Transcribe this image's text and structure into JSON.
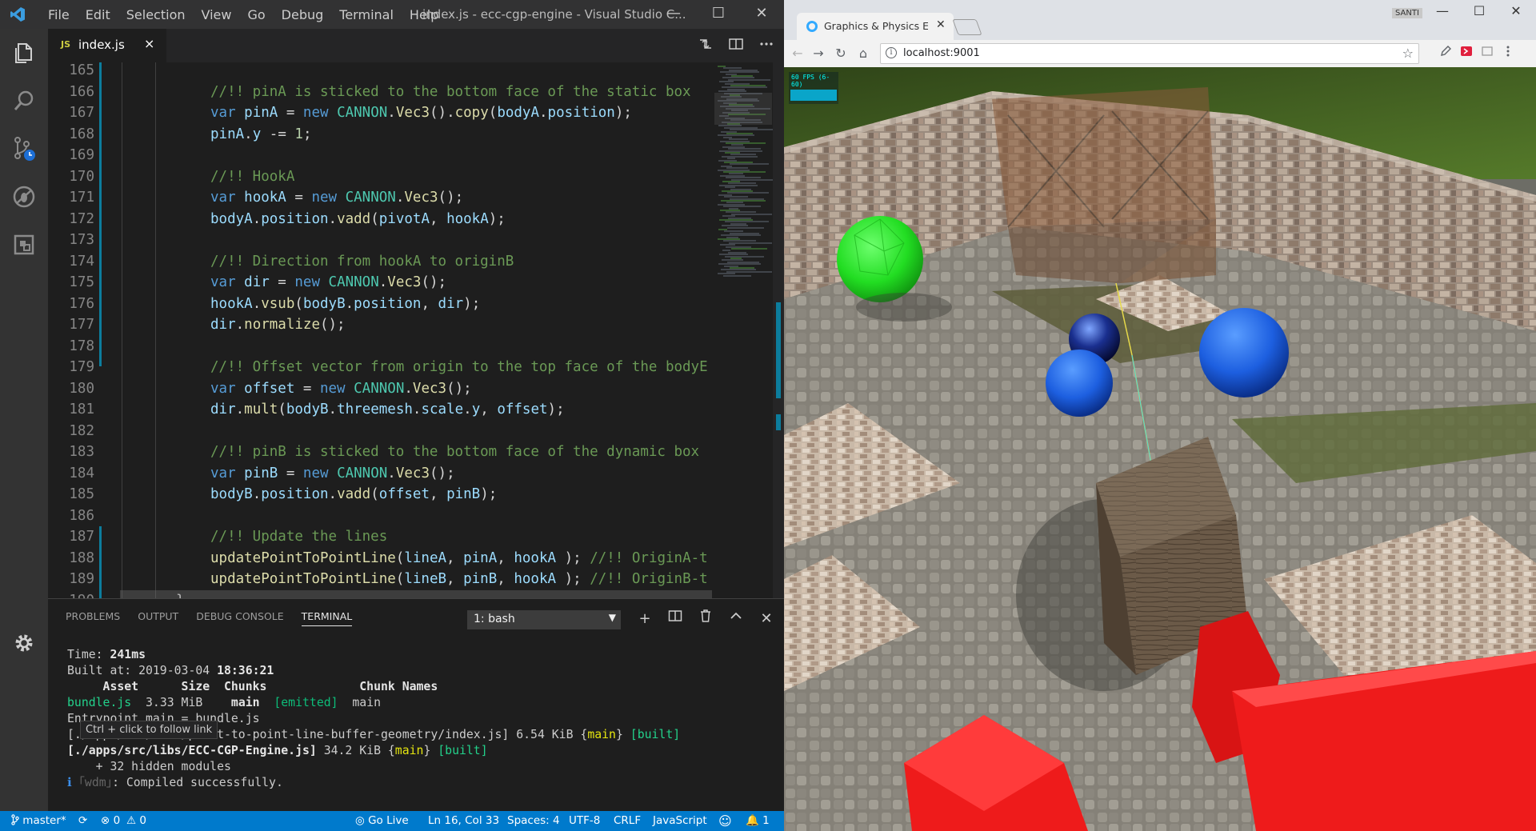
{
  "vscode": {
    "menu": [
      "File",
      "Edit",
      "Selection",
      "View",
      "Go",
      "Debug",
      "Terminal",
      "Help"
    ],
    "window_title": "index.js - ecc-cgp-engine - Visual Studio C...",
    "window_controls": {
      "minimize": "—",
      "maximize": "☐",
      "close": "✕"
    },
    "tab": {
      "icon": "JS",
      "name": "index.js",
      "close": "×"
    },
    "code_lines": [
      {
        "n": "165",
        "t": []
      },
      {
        "n": "166",
        "t": [
          [
            "cm",
            "//!! pinA is sticked to the bottom face of the static box"
          ]
        ]
      },
      {
        "n": "167",
        "t": [
          [
            "kw",
            "var "
          ],
          [
            "var",
            "pinA"
          ],
          [
            "pl",
            " = "
          ],
          [
            "kw",
            "new "
          ],
          [
            "cls",
            "CANNON"
          ],
          [
            "pl",
            "."
          ],
          [
            "fn",
            "Vec3"
          ],
          [
            "pl",
            "()."
          ],
          [
            "fn",
            "copy"
          ],
          [
            "pl",
            "("
          ],
          [
            "var",
            "bodyA"
          ],
          [
            "pl",
            "."
          ],
          [
            "var",
            "position"
          ],
          [
            "pl",
            ");"
          ]
        ]
      },
      {
        "n": "168",
        "t": [
          [
            "var",
            "pinA"
          ],
          [
            "pl",
            "."
          ],
          [
            "var",
            "y"
          ],
          [
            "pl",
            " -= "
          ],
          [
            "num",
            "1"
          ],
          [
            "pl",
            ";"
          ]
        ]
      },
      {
        "n": "169",
        "t": []
      },
      {
        "n": "170",
        "t": [
          [
            "cm",
            "//!! HookA"
          ]
        ]
      },
      {
        "n": "171",
        "t": [
          [
            "kw",
            "var "
          ],
          [
            "var",
            "hookA"
          ],
          [
            "pl",
            " = "
          ],
          [
            "kw",
            "new "
          ],
          [
            "cls",
            "CANNON"
          ],
          [
            "pl",
            "."
          ],
          [
            "fn",
            "Vec3"
          ],
          [
            "pl",
            "();"
          ]
        ]
      },
      {
        "n": "172",
        "t": [
          [
            "var",
            "bodyA"
          ],
          [
            "pl",
            "."
          ],
          [
            "var",
            "position"
          ],
          [
            "pl",
            "."
          ],
          [
            "fn",
            "vadd"
          ],
          [
            "pl",
            "("
          ],
          [
            "var",
            "pivotA"
          ],
          [
            "pl",
            ", "
          ],
          [
            "var",
            "hookA"
          ],
          [
            "pl",
            ");"
          ]
        ]
      },
      {
        "n": "173",
        "t": []
      },
      {
        "n": "174",
        "t": [
          [
            "cm",
            "//!! Direction from hookA to originB"
          ]
        ]
      },
      {
        "n": "175",
        "t": [
          [
            "kw",
            "var "
          ],
          [
            "var",
            "dir"
          ],
          [
            "pl",
            " = "
          ],
          [
            "kw",
            "new "
          ],
          [
            "cls",
            "CANNON"
          ],
          [
            "pl",
            "."
          ],
          [
            "fn",
            "Vec3"
          ],
          [
            "pl",
            "();"
          ]
        ]
      },
      {
        "n": "176",
        "t": [
          [
            "var",
            "hookA"
          ],
          [
            "pl",
            "."
          ],
          [
            "fn",
            "vsub"
          ],
          [
            "pl",
            "("
          ],
          [
            "var",
            "bodyB"
          ],
          [
            "pl",
            "."
          ],
          [
            "var",
            "position"
          ],
          [
            "pl",
            ", "
          ],
          [
            "var",
            "dir"
          ],
          [
            "pl",
            ");"
          ]
        ]
      },
      {
        "n": "177",
        "t": [
          [
            "var",
            "dir"
          ],
          [
            "pl",
            "."
          ],
          [
            "fn",
            "normalize"
          ],
          [
            "pl",
            "();"
          ]
        ]
      },
      {
        "n": "178",
        "t": []
      },
      {
        "n": "179",
        "t": [
          [
            "cm",
            "//!! Offset vector from origin to the top face of the bodyE"
          ]
        ]
      },
      {
        "n": "180",
        "t": [
          [
            "kw",
            "var "
          ],
          [
            "var",
            "offset"
          ],
          [
            "pl",
            " = "
          ],
          [
            "kw",
            "new "
          ],
          [
            "cls",
            "CANNON"
          ],
          [
            "pl",
            "."
          ],
          [
            "fn",
            "Vec3"
          ],
          [
            "pl",
            "();"
          ]
        ]
      },
      {
        "n": "181",
        "t": [
          [
            "var",
            "dir"
          ],
          [
            "pl",
            "."
          ],
          [
            "fn",
            "mult"
          ],
          [
            "pl",
            "("
          ],
          [
            "var",
            "bodyB"
          ],
          [
            "pl",
            "."
          ],
          [
            "var",
            "threemesh"
          ],
          [
            "pl",
            "."
          ],
          [
            "var",
            "scale"
          ],
          [
            "pl",
            "."
          ],
          [
            "var",
            "y"
          ],
          [
            "pl",
            ", "
          ],
          [
            "var",
            "offset"
          ],
          [
            "pl",
            ");"
          ]
        ]
      },
      {
        "n": "182",
        "t": []
      },
      {
        "n": "183",
        "t": [
          [
            "cm",
            "//!! pinB is sticked to the bottom face of the dynamic box"
          ]
        ]
      },
      {
        "n": "184",
        "t": [
          [
            "kw",
            "var "
          ],
          [
            "var",
            "pinB"
          ],
          [
            "pl",
            " = "
          ],
          [
            "kw",
            "new "
          ],
          [
            "cls",
            "CANNON"
          ],
          [
            "pl",
            "."
          ],
          [
            "fn",
            "Vec3"
          ],
          [
            "pl",
            "();"
          ]
        ]
      },
      {
        "n": "185",
        "t": [
          [
            "var",
            "bodyB"
          ],
          [
            "pl",
            "."
          ],
          [
            "var",
            "position"
          ],
          [
            "pl",
            "."
          ],
          [
            "fn",
            "vadd"
          ],
          [
            "pl",
            "("
          ],
          [
            "var",
            "offset"
          ],
          [
            "pl",
            ", "
          ],
          [
            "var",
            "pinB"
          ],
          [
            "pl",
            ");"
          ]
        ]
      },
      {
        "n": "186",
        "t": []
      },
      {
        "n": "187",
        "t": [
          [
            "cm",
            "//!! Update the lines"
          ]
        ]
      },
      {
        "n": "188",
        "t": [
          [
            "fn",
            "updatePointToPointLine"
          ],
          [
            "pl",
            "("
          ],
          [
            "var",
            "lineA"
          ],
          [
            "pl",
            ", "
          ],
          [
            "var",
            "pinA"
          ],
          [
            "pl",
            ", "
          ],
          [
            "var",
            "hookA"
          ],
          [
            "pl",
            " ); "
          ],
          [
            "cm",
            "//!! OriginA-t"
          ]
        ]
      },
      {
        "n": "189",
        "t": [
          [
            "fn",
            "updatePointToPointLine"
          ],
          [
            "pl",
            "("
          ],
          [
            "var",
            "lineB"
          ],
          [
            "pl",
            ", "
          ],
          [
            "var",
            "pinB"
          ],
          [
            "pl",
            ", "
          ],
          [
            "var",
            "hookA"
          ],
          [
            "pl",
            " ); "
          ],
          [
            "cm",
            "//!! OriginB-t"
          ]
        ]
      },
      {
        "n": "190",
        "t": [
          [
            "pl",
            "}"
          ]
        ]
      }
    ],
    "panel": {
      "tabs": [
        "PROBLEMS",
        "OUTPUT",
        "DEBUG CONSOLE",
        "TERMINAL"
      ],
      "active_tab": "TERMINAL",
      "terminal_select": "1: bash",
      "actions": {
        "add": "+",
        "split": "◫",
        "trash": "🗑",
        "maximize": "∧",
        "close": "✕"
      }
    },
    "terminal_lines": [
      [
        [
          "",
          "Time: "
        ],
        [
          "b",
          "241"
        ],
        [
          "b",
          "ms"
        ]
      ],
      [
        [
          "",
          "Built at: 2019-03-04 "
        ],
        [
          "b",
          "18:36:21"
        ]
      ],
      [
        [
          "b",
          "     Asset      Size  Chunks             Chunk Names"
        ]
      ],
      [
        [
          "g",
          "bundle.js"
        ],
        [
          "",
          "  3.33 MiB    "
        ],
        [
          "b",
          "main"
        ],
        [
          "gd",
          "  [emitted]"
        ],
        [
          "",
          "  main"
        ]
      ],
      [
        [
          "",
          "Entrypoint main = bundle.js"
        ]
      ],
      [
        [
          "",
          "[./apps/src/libs/point-to-point-line-buffer-geometry/index.js] 6.54 KiB {"
        ],
        [
          "y",
          "main"
        ],
        [
          "",
          "} "
        ],
        [
          "g",
          "[built]"
        ]
      ],
      [
        [
          "b",
          "[./apps/src/libs/ECC-CGP-Engine.js]"
        ],
        [
          "",
          " 34.2 KiB {"
        ],
        [
          "y",
          "main"
        ],
        [
          "",
          "} "
        ],
        [
          "g",
          "[built]"
        ]
      ],
      [
        [
          "",
          "    + 32 hidden modules"
        ]
      ],
      [
        [
          "bl",
          "ℹ "
        ],
        [
          "dim",
          "｢wdm｣"
        ],
        [
          "",
          ": Compiled successfully."
        ]
      ]
    ],
    "tooltip": "Ctrl + click to follow link",
    "status": {
      "branch": "master*",
      "sync": "⟳",
      "errors": "⊗ 0",
      "warnings": "⚠ 0",
      "go_live": "Go Live",
      "position": "Ln 16, Col 33",
      "spaces": "Spaces: 4",
      "encoding": "UTF-8",
      "eol": "CRLF",
      "language": "JavaScript",
      "smiley": "☺",
      "bell": "🔔 1"
    }
  },
  "browser": {
    "tab_title": "Graphics & Physics Engin",
    "tab_close": "✕",
    "profile": "SANTI",
    "window_controls": {
      "minimize": "—",
      "maximize": "☐",
      "close": "✕"
    },
    "nav": {
      "back": "←",
      "forward": "→",
      "reload": "↻",
      "home": "⌂"
    },
    "info_icon": "i",
    "url": "localhost:9001",
    "star": "☆",
    "fps_text": "60 FPS (6-60)"
  },
  "colors": {
    "vscode_bg": "#1e1e1e",
    "status_blue": "#007acc",
    "activity_bar": "#333333",
    "green_sphere": "#22ee22",
    "blue_sphere": "#1d6ee0",
    "red_box": "#ee1b1b"
  }
}
